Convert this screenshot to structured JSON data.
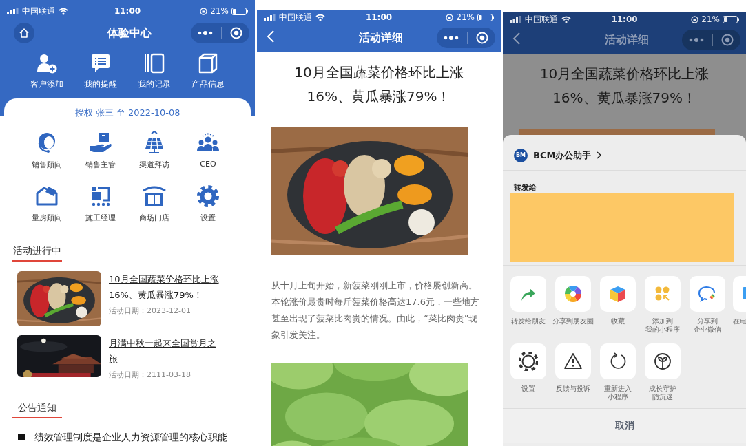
{
  "home_screen": {
    "status_bar": {
      "carrier": "中国联通",
      "time": "11:00",
      "battery": "21%"
    },
    "title": "体验中心",
    "quick_actions": [
      {
        "label": "客户添加"
      },
      {
        "label": "我的提醒"
      },
      {
        "label": "我的记录"
      },
      {
        "label": "产品信息"
      }
    ],
    "authorization": "授权 张三 至 2022-10-08",
    "roles": [
      {
        "label": "销售顾问"
      },
      {
        "label": "销售主管"
      },
      {
        "label": "渠道拜访"
      },
      {
        "label": "CEO"
      },
      {
        "label": "量房顾问"
      },
      {
        "label": "施工经理"
      },
      {
        "label": "商场门店"
      },
      {
        "label": "设置"
      }
    ],
    "activities": {
      "title": "活动进行中",
      "items": [
        {
          "title": "10月全国蔬菜价格环比上涨16%、黄瓜暴涨79%！",
          "date": "活动日期：2023-12-01",
          "image": {
            "kind": "picture"
          }
        },
        {
          "title": "月满中秋一起来全国赏月之旅",
          "date": "活动日期：2111-03-18",
          "image": {
            "kind": "picture"
          }
        }
      ]
    },
    "notices": {
      "title": "公告通知",
      "items": [
        "绩效管理制度是企业人力资源管理的核心职能"
      ]
    }
  },
  "detail_screen": {
    "status_bar": {
      "carrier": "中国联通",
      "time": "11:00",
      "battery": "21%"
    },
    "title": "活动详细",
    "article_title": "10月全国蔬菜价格环比上涨16%、黄瓜暴涨79%！",
    "blocks": [
      {
        "kind": "picture"
      },
      {
        "kind": "paragraph",
        "text": "从十月上旬开始，新菠菜刚刚上市，价格屡创新高。本轮涨价最贵时每斤菠菜价格高达17.6元，一些地方甚至出现了菠菜比肉贵的情况。由此，“菜比肉贵”现象引发关注。"
      },
      {
        "kind": "picture"
      }
    ]
  },
  "share_screen": {
    "status_bar": {
      "carrier": "中国联通",
      "time": "11:00",
      "battery": "21%"
    },
    "title": "活动详细",
    "article_title": "10月全国蔬菜价格环比上涨16%、黄瓜暴涨79%！",
    "image": {
      "kind": "picture"
    },
    "sheet": {
      "app_logo": "BM",
      "app_name": "BCM办公助手",
      "forward_label": "转发给",
      "actions": [
        {
          "label_lines": [
            "转发给朋友"
          ]
        },
        {
          "label_lines": [
            "分享到朋友圈"
          ]
        },
        {
          "label_lines": [
            "收藏"
          ]
        },
        {
          "label_lines": [
            "添加到",
            "我的小程序"
          ]
        },
        {
          "label_lines": [
            "分享到",
            "企业微信"
          ]
        },
        {
          "label_lines": [
            "在电"
          ]
        }
      ],
      "more_actions": [
        {
          "label_lines": [
            "设置"
          ]
        },
        {
          "label_lines": [
            "反馈与投诉"
          ]
        },
        {
          "label_lines": [
            "重新进入",
            "小程序"
          ]
        },
        {
          "label_lines": [
            "成长守护",
            "防沉迷"
          ]
        }
      ],
      "cancel": "取消"
    }
  }
}
